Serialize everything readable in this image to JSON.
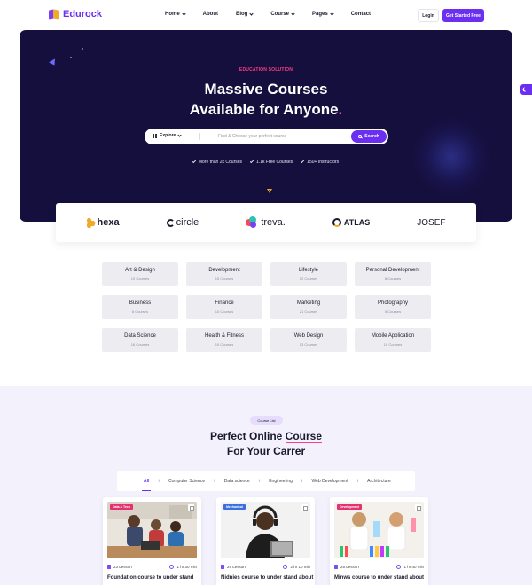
{
  "brand": {
    "name": "Edurock"
  },
  "nav": [
    {
      "label": "Home",
      "dropdown": true
    },
    {
      "label": "About",
      "dropdown": false
    },
    {
      "label": "Blog",
      "dropdown": true
    },
    {
      "label": "Course",
      "dropdown": true
    },
    {
      "label": "Pages",
      "dropdown": true
    },
    {
      "label": "Contact",
      "dropdown": false
    }
  ],
  "header": {
    "login_label": "Login",
    "cta_label": "Get Started Free"
  },
  "hero": {
    "eyebrow": "EDUCATION SOLUTION",
    "title_line1": "Massive Courses",
    "title_line2": "Available for Anyone",
    "title_dot": ".",
    "explore_label": "Explore",
    "search_placeholder": "Find & Choose your perfect course",
    "search_button": "Search",
    "features": [
      "More than 2k Courses",
      "1.1k Free Courses",
      "150+ Instructors"
    ]
  },
  "brands": [
    "hexa",
    "circle",
    "treva.",
    "ATLAS",
    "JOSEF"
  ],
  "categories": [
    {
      "name": "Art & Design",
      "count": "10 Courses"
    },
    {
      "name": "Development",
      "count": "15 Courses"
    },
    {
      "name": "Lifestyle",
      "count": "12 Courses"
    },
    {
      "name": "Personal Development",
      "count": "8 Courses"
    },
    {
      "name": "Business",
      "count": "8 Courses"
    },
    {
      "name": "Finance",
      "count": "10 Courses"
    },
    {
      "name": "Marketing",
      "count": "21 Courses"
    },
    {
      "name": "Photography",
      "count": "5 Courses"
    },
    {
      "name": "Data Science",
      "count": "16 Courses"
    },
    {
      "name": "Health & Fitness",
      "count": "10 Courses"
    },
    {
      "name": "Web Design",
      "count": "13 Courses"
    },
    {
      "name": "Mobile Application",
      "count": "10 Courses"
    }
  ],
  "course_section": {
    "pill": "Course List",
    "title_part1": "Perfect Online ",
    "title_underlined": "Course",
    "title_line2": "For Your Carrer",
    "tabs": [
      "All",
      "Computer Science",
      "Data science",
      "Engineering",
      "Web Development",
      "Architecture"
    ],
    "active_tab": "All"
  },
  "courses": [
    {
      "badge": "Data & Tech",
      "badge_color": "#e4316f",
      "lessons": "23 Lesson",
      "duration": "1 hr 30 min",
      "title": "Foundation course to under stand"
    },
    {
      "badge": "Mechanical",
      "badge_color": "#3b6fe0",
      "lessons": "29 Lesson",
      "duration": "2 hr 10 min",
      "title": "Nidnies course to under stand about"
    },
    {
      "badge": "Development",
      "badge_color": "#e4316f",
      "lessons": "25 Lesson",
      "duration": "1 hr 40 min",
      "title": "Minws course to under stand about"
    }
  ],
  "colors": {
    "accent": "#6a2ff0",
    "pink": "#ff3c88",
    "hero_bg": "#150f3d",
    "section_bg": "#f3f1fb"
  }
}
